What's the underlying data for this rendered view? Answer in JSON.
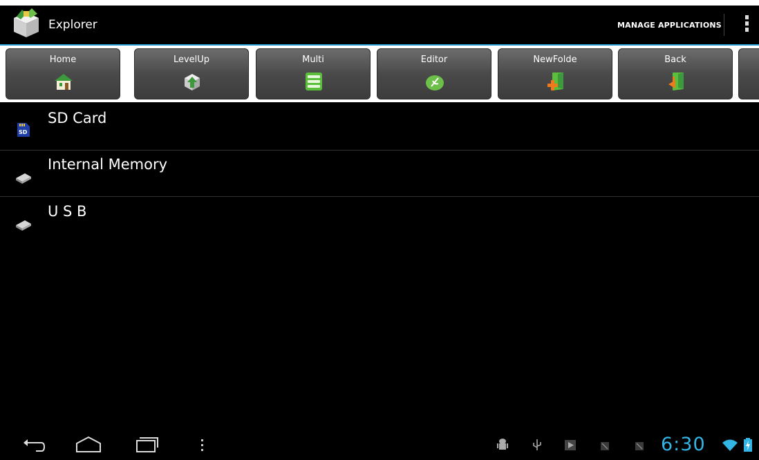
{
  "app": {
    "title": "Explorer",
    "icon": "explorer-box-icon"
  },
  "action_bar": {
    "manage_label": "MANAGE APPLICATIONS",
    "overflow_icon": "overflow-menu-icon",
    "accent_color": "#2a9fd6"
  },
  "toolbar": {
    "buttons": [
      {
        "label": "Home",
        "icon": "home-icon"
      },
      {
        "label": "LevelUp",
        "icon": "level-up-icon"
      },
      {
        "label": "Multi",
        "icon": "multi-select-icon"
      },
      {
        "label": "Editor",
        "icon": "editor-icon"
      },
      {
        "label": "NewFolde",
        "icon": "new-folder-icon"
      },
      {
        "label": "Back",
        "icon": "back-icon"
      }
    ]
  },
  "storage": {
    "items": [
      {
        "label": "SD Card",
        "icon": "sd-card-icon"
      },
      {
        "label": "Internal Memory",
        "icon": "drive-icon"
      },
      {
        "label": "U S B",
        "icon": "usb-drive-icon"
      }
    ]
  },
  "nav_bar": {
    "back_icon": "back-nav-icon",
    "home_icon": "home-nav-icon",
    "recents_icon": "recent-apps-icon",
    "menu_icon": "menu-icon"
  },
  "status_bar": {
    "time": "6:30",
    "clock_color": "#33b5e5",
    "icons": [
      "android-debug-icon",
      "usb-icon",
      "play-store-icon",
      "notification-icon",
      "notification-icon",
      "wifi-icon",
      "battery-icon"
    ]
  }
}
